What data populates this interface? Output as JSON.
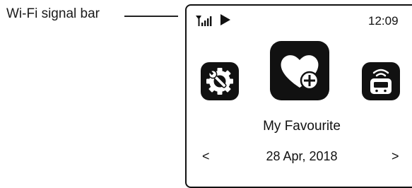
{
  "callout": {
    "label": "Wi-Fi signal bar"
  },
  "status_bar": {
    "time": "12:09",
    "signal_icon": "wifi-signal-icon",
    "play_icon": "play-icon"
  },
  "menu": {
    "items": [
      {
        "icon": "settings-icon"
      },
      {
        "icon": "favourite-heart-add-icon"
      },
      {
        "icon": "radio-remote-icon"
      }
    ],
    "selected_label": "My Favourite"
  },
  "date_nav": {
    "prev": "<",
    "date": "28 Apr, 2018",
    "next": ">"
  }
}
